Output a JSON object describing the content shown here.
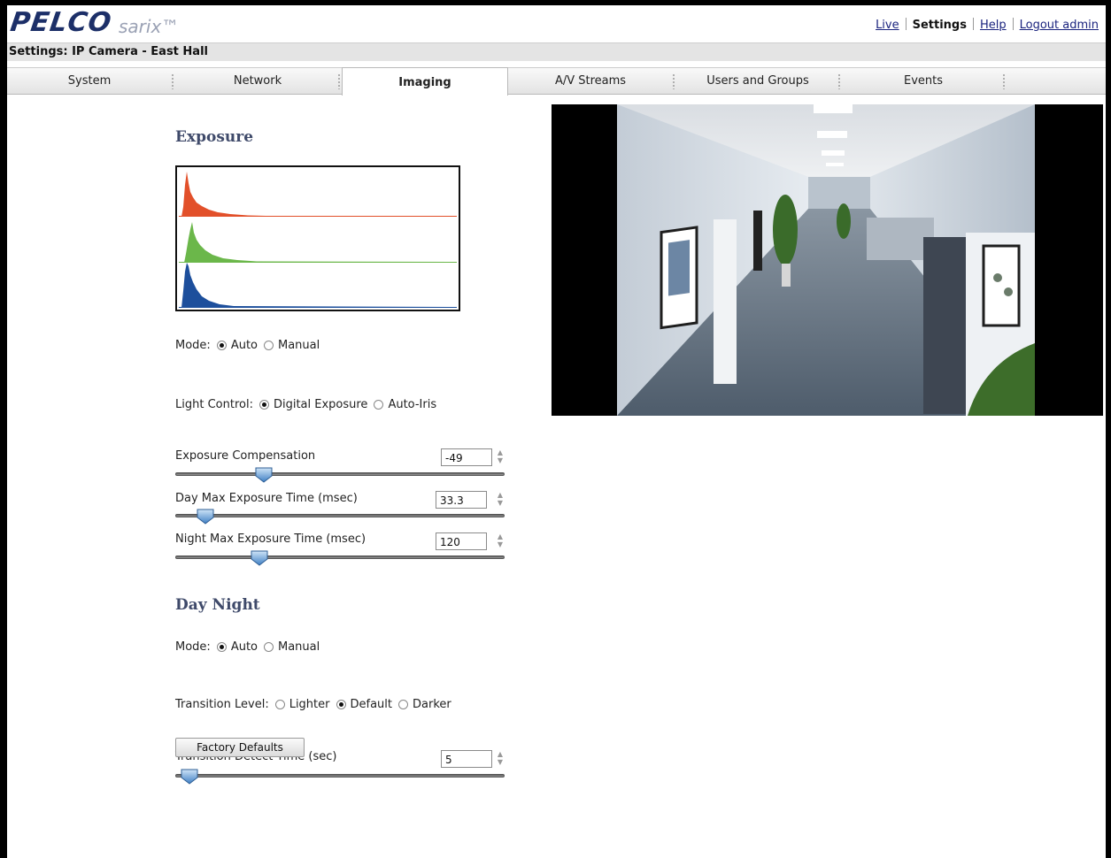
{
  "logo": {
    "brand": "PELCO",
    "product": "sarix™"
  },
  "top_nav": {
    "live": "Live",
    "settings": "Settings",
    "help": "Help",
    "logout": "Logout admin"
  },
  "page_title": "Settings: IP Camera - East Hall",
  "tabs": [
    {
      "label": "System"
    },
    {
      "label": "Network"
    },
    {
      "label": "Imaging",
      "active": true
    },
    {
      "label": "A/V Streams"
    },
    {
      "label": "Users and Groups"
    },
    {
      "label": "Events"
    }
  ],
  "exposure": {
    "title": "Exposure",
    "mode": {
      "label": "Mode:",
      "options": [
        "Auto",
        "Manual"
      ],
      "selected": "Auto"
    },
    "light_control": {
      "label": "Light Control:",
      "options": [
        "Digital Exposure",
        "Auto-Iris"
      ],
      "selected": "Digital Exposure"
    },
    "compensation": {
      "label": "Exposure Compensation",
      "value": "-49"
    },
    "day_max": {
      "label": "Day Max Exposure Time (msec)",
      "value": "33.3"
    },
    "night_max": {
      "label": "Night Max Exposure Time (msec)",
      "value": "120"
    }
  },
  "day_night": {
    "title": "Day Night",
    "mode": {
      "label": "Mode:",
      "options": [
        "Auto",
        "Manual"
      ],
      "selected": "Auto"
    },
    "transition_level": {
      "label": "Transition Level:",
      "options": [
        "Lighter",
        "Default",
        "Darker"
      ],
      "selected": "Default"
    },
    "detect_time": {
      "label": "Transition Detect Time (sec)",
      "value": "5"
    }
  },
  "factory_defaults_label": "Factory Defaults",
  "colors": {
    "brand": "#1c2f68",
    "section_title": "#3f4a6a",
    "histogram_red": "#e2502a",
    "histogram_green": "#6bb74a",
    "histogram_blue": "#1d4f9c",
    "slider_thumb": "#4f8fd0"
  },
  "icons": {
    "radio": "radio-icon",
    "spinner": "spin-arrows-icon",
    "slider": "slider-thumb-icon"
  }
}
